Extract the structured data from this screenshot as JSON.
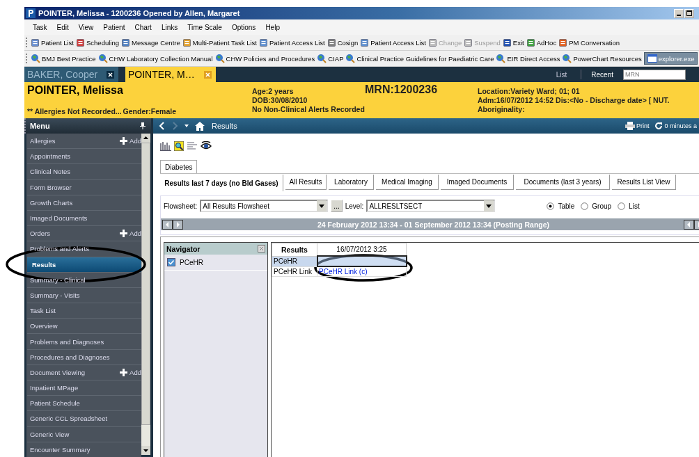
{
  "window": {
    "title": "POINTER, Melissa - 1200236 Opened by Allen, Margaret"
  },
  "menu_bar": [
    "Task",
    "Edit",
    "View",
    "Patient",
    "Chart",
    "Links",
    "Time Scale",
    "Options",
    "Help"
  ],
  "toolbar": [
    {
      "label": "Patient List",
      "disabled": false
    },
    {
      "label": "Scheduling",
      "disabled": false
    },
    {
      "label": "Message Centre",
      "disabled": false
    },
    {
      "label": "Multi-Patient Task List",
      "disabled": false
    },
    {
      "label": "Patient Access List",
      "disabled": false
    },
    {
      "label": "Cosign",
      "disabled": false
    },
    {
      "label": "Patient Access List",
      "disabled": false
    },
    {
      "label": "Change",
      "disabled": true
    },
    {
      "label": "Suspend",
      "disabled": true
    },
    {
      "label": "Exit",
      "disabled": false
    },
    {
      "label": "AdHoc",
      "disabled": false
    },
    {
      "label": "PM Conversation",
      "disabled": false
    }
  ],
  "links_bar": [
    {
      "label": "BMJ Best Practice",
      "kind": "link"
    },
    {
      "label": "CHW Laboratory Collection Manual",
      "kind": "link"
    },
    {
      "label": "CHW Policies and Procedures",
      "kind": "link"
    },
    {
      "label": "CIAP",
      "kind": "link"
    },
    {
      "label": "Clinical Practice Guidelines for Paediatric Care",
      "kind": "link"
    },
    {
      "label": "EIR Direct Access",
      "kind": "link"
    },
    {
      "label": "PowerChart Resources",
      "kind": "link"
    },
    {
      "label": "explorer.exe",
      "kind": "task"
    }
  ],
  "patient_tabs": [
    {
      "label": "BAKER, Cooper",
      "selected": false
    },
    {
      "label": "POINTER, M…",
      "selected": true
    }
  ],
  "patient_nav": {
    "list": "List",
    "recent": "Recent",
    "search_placeholder": "MRN"
  },
  "banner": {
    "name": "POINTER, Melissa",
    "allergies": "** Allergies Not Recorded...",
    "gender": "Gender:Female",
    "age": "Age:2 years",
    "dob": "DOB:30/08/2010",
    "alerts": "No Non-Clinical Alerts Recorded",
    "mrn": "MRN:1200236",
    "location": "Location:Variety Ward; 01; 01",
    "admission": "Adm:16/07/2012 14:52 Dis:<No - Discharge date> [ NUT.",
    "aboriginality": "Aboriginality:"
  },
  "sidebar": {
    "title": "Menu",
    "items": [
      {
        "label": "Allergies",
        "add": "Add",
        "selected": false
      },
      {
        "label": "Appointments",
        "selected": false
      },
      {
        "label": "Clinical Notes",
        "selected": false
      },
      {
        "label": "Form Browser",
        "selected": false
      },
      {
        "label": "Growth Charts",
        "selected": false
      },
      {
        "label": "Imaged Documents",
        "selected": false
      },
      {
        "label": "Orders",
        "add": "Add",
        "selected": false
      },
      {
        "label": "Problems and Alerts",
        "selected": false
      },
      {
        "label": "Results",
        "selected": true
      },
      {
        "label": "Summary - Clinical",
        "selected": false
      },
      {
        "label": "Summary - Visits",
        "selected": false
      },
      {
        "label": "Task List",
        "selected": false
      },
      {
        "label": "Overview",
        "selected": false
      },
      {
        "label": "Problems and Diagnoses",
        "selected": false
      },
      {
        "label": "Procedures and Diagnoses",
        "selected": false
      },
      {
        "label": "Document Viewing",
        "add": "Add",
        "selected": false
      },
      {
        "label": "Inpatient MPage",
        "selected": false
      },
      {
        "label": "Patient Schedule",
        "selected": false
      },
      {
        "label": "Generic CCL Spreadsheet",
        "selected": false
      },
      {
        "label": "Generic View",
        "selected": false
      },
      {
        "label": "Encounter Summary",
        "selected": false
      }
    ]
  },
  "content_header": {
    "title": "Results",
    "print": "Print",
    "refresh": "0 minutes a"
  },
  "group_tabs": [
    {
      "label": "Diabetes",
      "selected": true
    }
  ],
  "result_tabs": [
    {
      "label": "Results last 7 days (no Bld Gases)",
      "selected": true
    },
    {
      "label": "All Results",
      "selected": false
    },
    {
      "label": "Laboratory",
      "selected": false
    },
    {
      "label": "Medical Imaging",
      "selected": false
    },
    {
      "label": "Imaged Documents",
      "selected": false
    },
    {
      "label": "Documents (last 3 years)",
      "selected": false
    },
    {
      "label": "Results List View",
      "selected": false
    }
  ],
  "filters": {
    "flowsheet_label": "Flowsheet:",
    "flowsheet": "All Results Flowsheet",
    "browse": "...",
    "level_label": "Level:",
    "level": "ALLRESLTSECT",
    "views": [
      {
        "label": "Table",
        "selected": true
      },
      {
        "label": "Group",
        "selected": false
      },
      {
        "label": "List",
        "selected": false
      }
    ]
  },
  "range": "24 February 2012 13:34 - 01 September 2012 13:34 (Posting Range)",
  "navigator": {
    "title": "Navigator",
    "items": [
      {
        "label": "PCeHR",
        "checked": true
      }
    ]
  },
  "results_table": {
    "header": "Results",
    "column": "16/07/2012 3:25",
    "rows": [
      {
        "label": "PCeHR",
        "value": "",
        "selected": true
      },
      {
        "label": "PCeHR Link",
        "value": "PCeHR Link (c)",
        "selected": false
      }
    ]
  }
}
